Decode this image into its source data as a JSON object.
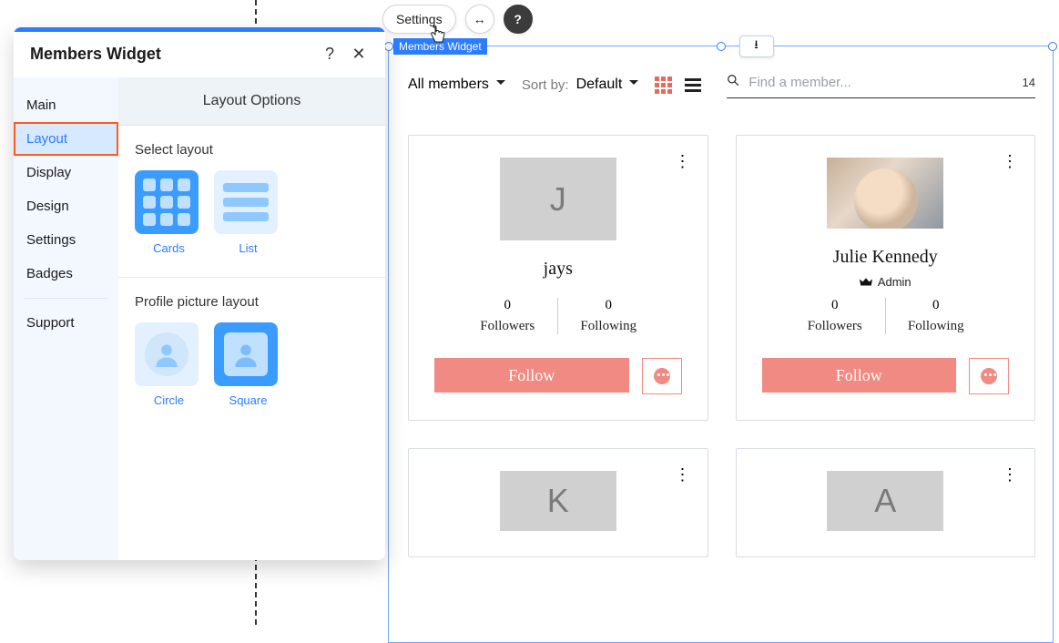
{
  "toolbar": {
    "settings_label": "Settings",
    "stretch_glyph": "↔",
    "help_glyph": "?"
  },
  "widget_tag": "Members Widget",
  "panel": {
    "title": "Members Widget",
    "help_glyph": "?",
    "close_glyph": "✕",
    "nav": {
      "main": "Main",
      "layout": "Layout",
      "display": "Display",
      "design": "Design",
      "settings": "Settings",
      "badges": "Badges",
      "support": "Support"
    },
    "options_header": "Layout Options",
    "section_layout_label": "Select layout",
    "layout_cards": "Cards",
    "layout_list": "List",
    "section_pic_label": "Profile picture layout",
    "pic_circle": "Circle",
    "pic_square": "Square"
  },
  "preview": {
    "filter_label": "All members",
    "sort_prefix": "Sort by:",
    "sort_value": "Default",
    "search_placeholder": "Find a member...",
    "count": "14",
    "follow_label": "Follow",
    "followers_label": "Followers",
    "following_label": "Following",
    "admin_label": "Admin",
    "members": [
      {
        "initial": "J",
        "name": "jays",
        "is_admin": false,
        "followers": "0",
        "following": "0",
        "has_photo": false
      },
      {
        "initial": "",
        "name": "Julie Kennedy",
        "is_admin": true,
        "followers": "0",
        "following": "0",
        "has_photo": true
      },
      {
        "initial": "K",
        "name": "",
        "is_admin": false,
        "followers": "",
        "following": "",
        "has_photo": false
      },
      {
        "initial": "A",
        "name": "",
        "is_admin": false,
        "followers": "",
        "following": "",
        "has_photo": false
      }
    ]
  },
  "download_glyph": "⭳"
}
